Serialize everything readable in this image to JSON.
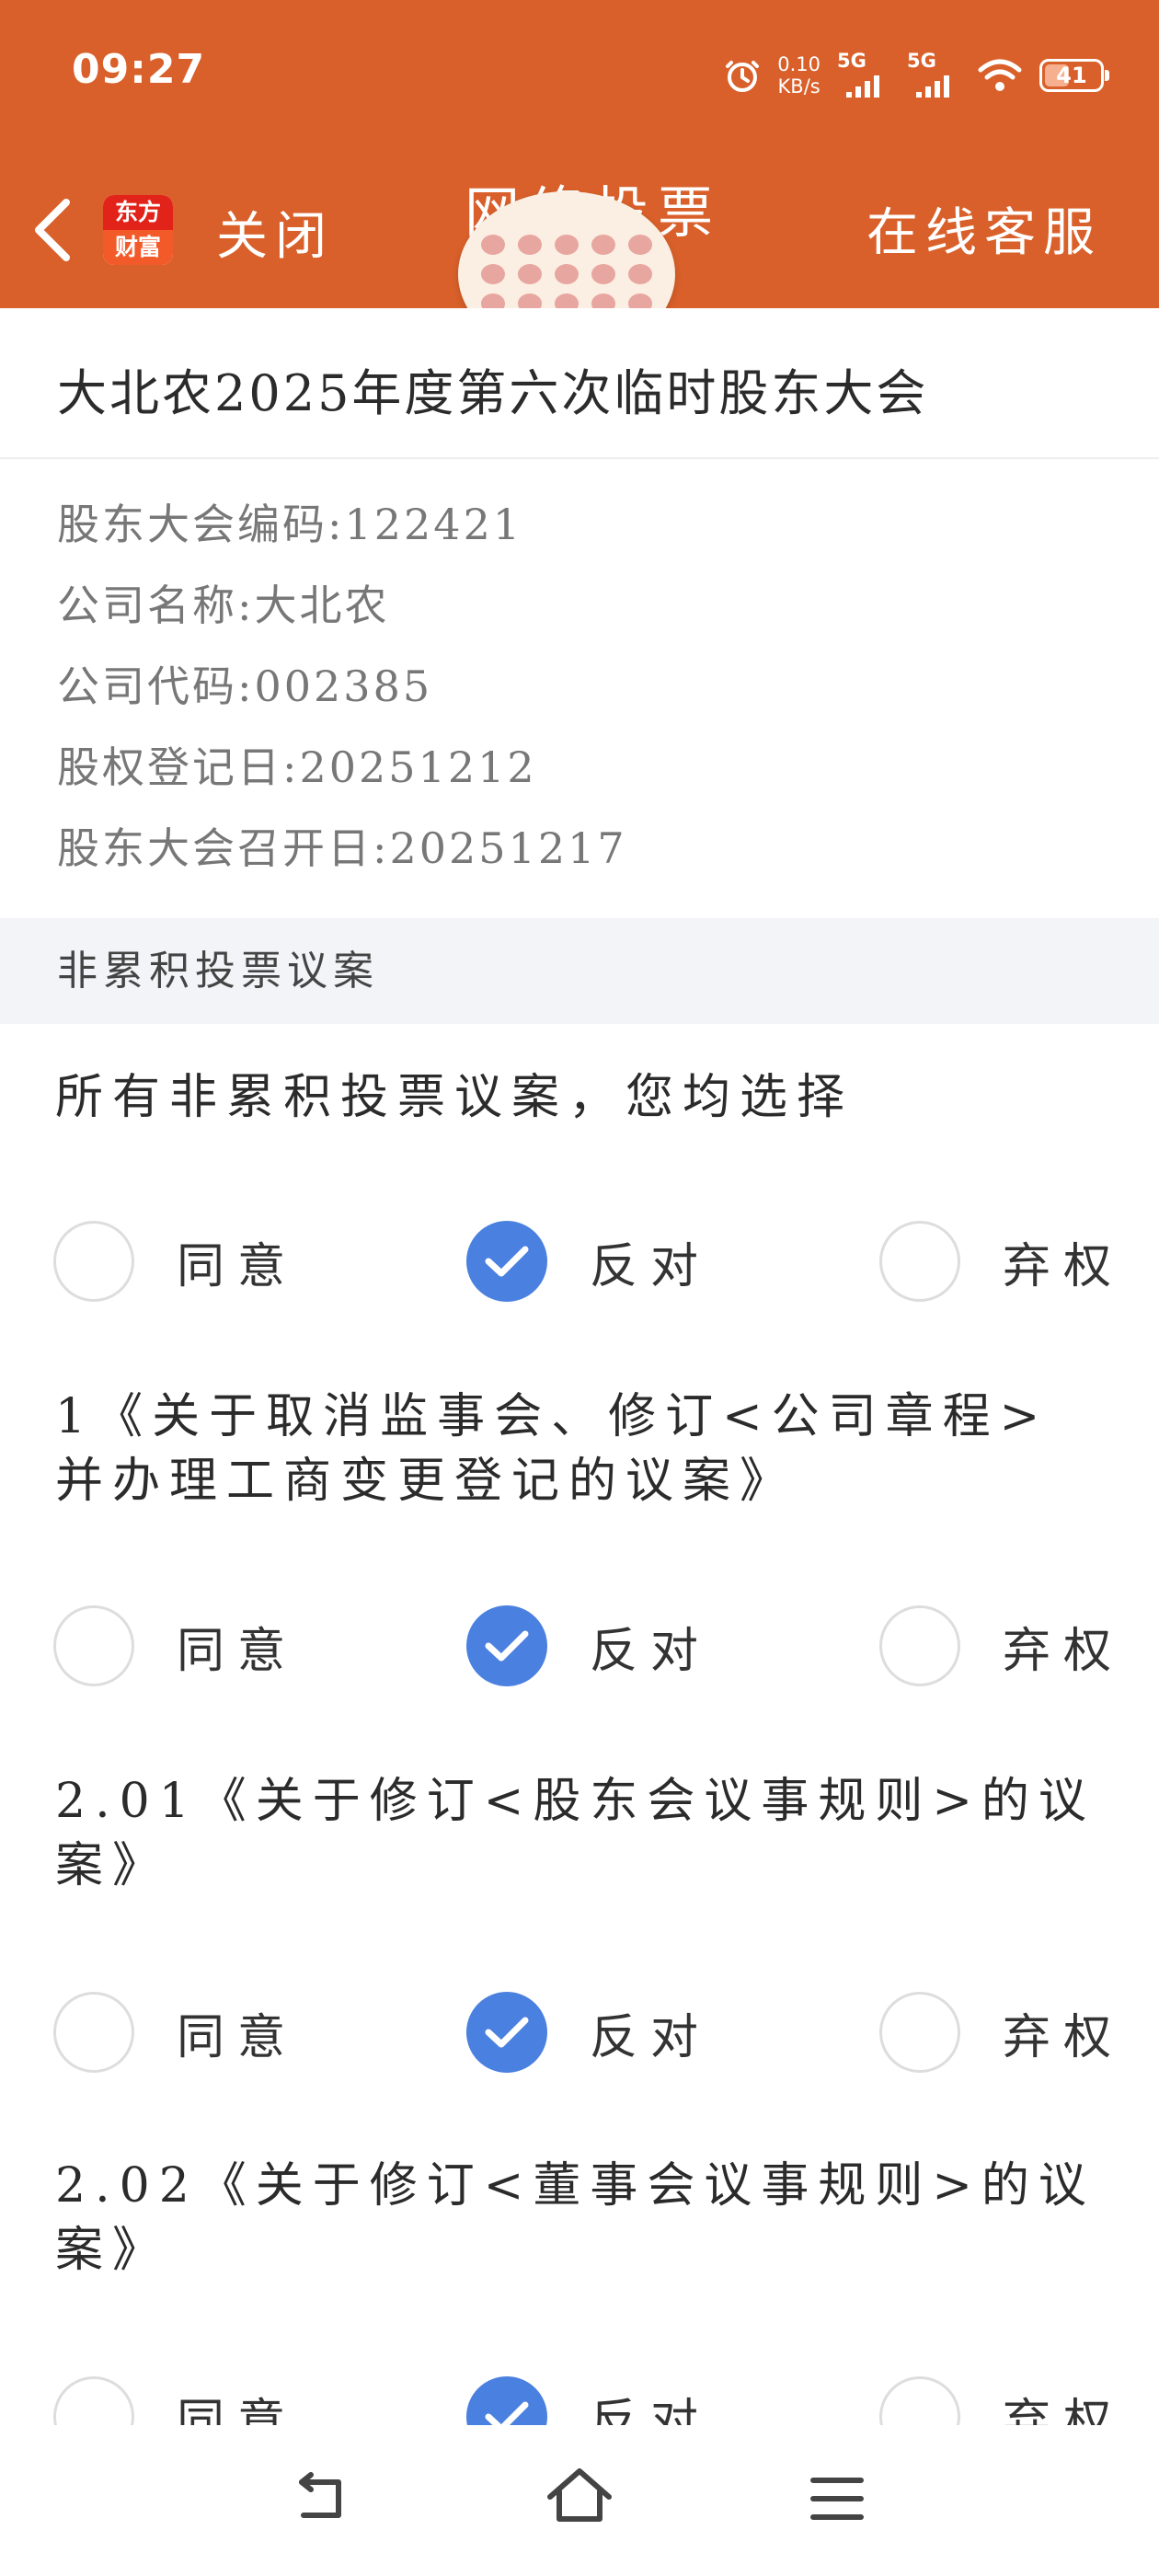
{
  "status_bar": {
    "time": "09:27",
    "net_speed_value": "0.10",
    "net_speed_unit": "KB/s",
    "sim1": "5G",
    "sim2": "5G",
    "battery": "41",
    "battery_level_percent": 41
  },
  "header": {
    "close_label": "关闭",
    "logo_top": "东方",
    "logo_bottom": "财富",
    "title": "网络投票",
    "service_label": "在线客服"
  },
  "meeting": {
    "title": "大北农2025年度第六次临时股东大会",
    "info": [
      "股东大会编码:122421",
      "公司名称:大北农",
      "公司代码:002385",
      "股权登记日:20251212",
      "股东大会召开日:20251217"
    ]
  },
  "section": {
    "title": "非累积投票议案"
  },
  "option_labels": {
    "agree": "同意",
    "oppose": "反对",
    "abstain": "弃权"
  },
  "motions": [
    {
      "title": "所有非累积投票议案，您均选择",
      "selected": "oppose"
    },
    {
      "title": "1《关于取消监事会、修订<公司章程>并办理工商变更登记的议案》",
      "selected": "oppose"
    },
    {
      "title": "2.01《关于修订<股东会议事规则>的议案》",
      "selected": "oppose"
    },
    {
      "title": "2.02《关于修订<董事会议事规则>的议案》",
      "selected": "oppose"
    }
  ],
  "icons": {
    "back": "chevron-left-icon",
    "alarm": "alarm-clock-icon",
    "wifi": "wifi-icon",
    "nav_back": "back-arrow-icon",
    "nav_home": "home-icon",
    "nav_menu": "menu-icon"
  },
  "colors": {
    "header_bg": "#D9602A",
    "checked_radio": "#4A80DF",
    "section_bg": "#F2F4F7"
  }
}
